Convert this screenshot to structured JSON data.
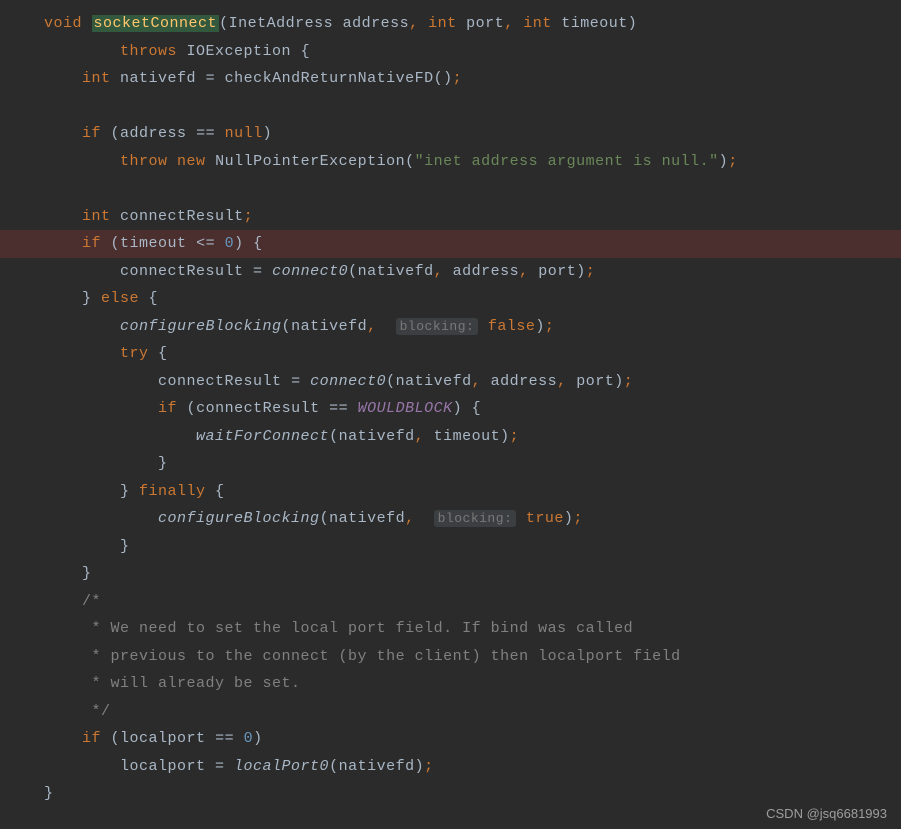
{
  "code": {
    "l1": {
      "kw_void": "void",
      "method": "socketConnect",
      "p_open": "(",
      "t1": "InetAddress",
      "a1": " address",
      "c1": ",",
      "sp1": " ",
      "t2": "int",
      "a2": " port",
      "c2": ",",
      "sp2": " ",
      "t3": "int",
      "a3": " timeout",
      "p_close": ")"
    },
    "l2": {
      "kw_throws": "throws",
      "ex": " IOException ",
      "brace": "{"
    },
    "l3": {
      "t": "int",
      "sp": " ",
      "var": "nativefd",
      "eq": " = ",
      "call": "checkAndReturnNativeFD",
      "paren": "()",
      "semi": ";"
    },
    "l5": {
      "kw": "if",
      "sp": " (",
      "var": "address",
      "eq": " == ",
      "nul": "null",
      "close": ")"
    },
    "l6": {
      "kw_throw": "throw",
      "sp": " ",
      "kw_new": "new",
      "sp2": " ",
      "cls": "NullPointerException",
      "open": "(",
      "str": "\"inet address argument is null.\"",
      "close": ")",
      "semi": ";"
    },
    "l8": {
      "t": "int",
      "sp": " ",
      "var": "connectResult",
      "semi": ";"
    },
    "l9": {
      "kw": "if",
      "sp": " (",
      "var": "timeout",
      "op": " <= ",
      "num": "0",
      "close": ") {"
    },
    "l10": {
      "var": "connectResult",
      "eq": " = ",
      "call": "connect0",
      "open": "(",
      "a1": "nativefd",
      "c1": ",",
      "sp1": " ",
      "a2": "address",
      "c2": ",",
      "sp2": " ",
      "a3": "port",
      "close": ")",
      "semi": ";"
    },
    "l11": {
      "close": "} ",
      "kw": "else",
      "brace": " {"
    },
    "l12": {
      "call": "configureBlocking",
      "open": "(",
      "a1": "nativefd",
      "c1": ",",
      "sp": "  ",
      "hint": "blocking:",
      "sp2": " ",
      "val": "false",
      "close": ")",
      "semi": ";"
    },
    "l13": {
      "kw": "try",
      "brace": " {"
    },
    "l14": {
      "var": "connectResult",
      "eq": " = ",
      "call": "connect0",
      "open": "(",
      "a1": "nativefd",
      "c1": ",",
      "sp1": " ",
      "a2": "address",
      "c2": ",",
      "sp2": " ",
      "a3": "port",
      "close": ")",
      "semi": ";"
    },
    "l15": {
      "kw": "if",
      "sp": " (",
      "var": "connectResult",
      "eq": " == ",
      "const": "WOULDBLOCK",
      "close": ") {"
    },
    "l16": {
      "call": "waitForConnect",
      "open": "(",
      "a1": "nativefd",
      "c1": ",",
      "sp": " ",
      "a2": "timeout",
      "close": ")",
      "semi": ";"
    },
    "l17": {
      "brace": "}"
    },
    "l18": {
      "close": "} ",
      "kw": "finally",
      "brace": " {"
    },
    "l19": {
      "call": "configureBlocking",
      "open": "(",
      "a1": "nativefd",
      "c1": ",",
      "sp": "  ",
      "hint": "blocking:",
      "sp2": " ",
      "val": "true",
      "close": ")",
      "semi": ";"
    },
    "l20": {
      "brace": "}"
    },
    "l21": {
      "brace": "}"
    },
    "l22": {
      "c": "/*"
    },
    "l23": {
      "c": " * We need to set the local port field. If bind was called"
    },
    "l24": {
      "c": " * previous to the connect (by the client) then localport field"
    },
    "l25": {
      "c": " * will already be set."
    },
    "l26": {
      "c": " */"
    },
    "l27": {
      "kw": "if",
      "sp": " (",
      "var": "localport",
      "eq": " == ",
      "num": "0",
      "close": ")"
    },
    "l28": {
      "var": "localport",
      "eq": " = ",
      "call": "localPort0",
      "open": "(",
      "a1": "nativefd",
      "close": ")",
      "semi": ";"
    },
    "l29": {
      "brace": "}"
    }
  },
  "watermark": "CSDN @jsq6681993"
}
